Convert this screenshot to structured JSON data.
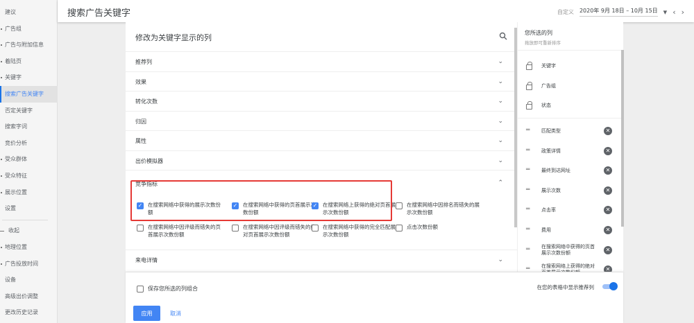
{
  "sidebar": {
    "items": [
      {
        "label": "建议",
        "dot": false
      },
      {
        "label": "广告组",
        "dot": true
      },
      {
        "label": "广告与附加信息",
        "dot": true
      },
      {
        "label": "着陆页",
        "dot": true
      },
      {
        "label": "关键字",
        "dot": true
      },
      {
        "label": "搜索广告关键字",
        "dot": false,
        "active": true
      },
      {
        "label": "否定关键字",
        "dot": false
      },
      {
        "label": "搜索字词",
        "dot": false
      },
      {
        "label": "竞价分析",
        "dot": false
      },
      {
        "label": "受众群体",
        "dot": true
      },
      {
        "label": "受众特征",
        "dot": true
      },
      {
        "label": "展示位置",
        "dot": true
      },
      {
        "label": "设置",
        "dot": false
      }
    ],
    "collapse_label": "收起",
    "more_items": [
      {
        "label": "地理位置",
        "dot": true
      },
      {
        "label": "广告投放时间",
        "dot": true
      },
      {
        "label": "设备",
        "dot": false
      },
      {
        "label": "高级出价调整",
        "dot": false
      },
      {
        "label": "更改历史记录",
        "dot": false
      }
    ]
  },
  "header": {
    "title": "搜索广告关键字",
    "date_label": "自定义",
    "date_value": "2020年 9月 18日 – 10月 15日",
    "prev": "‹",
    "next": "›",
    "dropdown": "▾"
  },
  "main": {
    "title": "修改为关键字显示的列",
    "sections": [
      "推荐列",
      "效果",
      "转化次数",
      "归因",
      "属性",
      "出价模拟器"
    ],
    "competition": {
      "title": "竞争指标",
      "checkboxes": [
        {
          "label": "在搜索网络中获得的展示次数份额",
          "checked": true
        },
        {
          "label": "在搜索网络中获得的页首展示次数份额",
          "checked": true
        },
        {
          "label": "在搜索网络上获得的绝对页首展示次数份额",
          "checked": true
        },
        {
          "label": "在搜索网络中因排名而错失的展示次数份额",
          "checked": false
        },
        {
          "label": "在搜索网络中因评级而错失的页首展示次数份额",
          "checked": false
        },
        {
          "label": "在搜索网络中因评级而错失的绝对页首展示次数份额",
          "checked": false
        },
        {
          "label": "在搜索网络中获得的完全匹配展示次数份额",
          "checked": false
        },
        {
          "label": "点击次数份额",
          "checked": false
        }
      ]
    },
    "after_section": "来电详情"
  },
  "right": {
    "title": "您所选的列",
    "subtitle": "拖放即可重新排序",
    "locked": [
      "关键字",
      "广告组",
      "状态"
    ],
    "items": [
      "匹配类型",
      "政策详情",
      "最终到达网址",
      "展示次数",
      "点击率",
      "费用",
      "在搜索网络中获得的页首展示次数份额",
      "在搜索网络上获得的绝对页首展示次数份额"
    ]
  },
  "footer": {
    "save_combo": "保存您所选的列组合",
    "show_recommended": "在您的表格中显示推荐列",
    "apply": "应用",
    "cancel": "取消"
  },
  "colors": {
    "accent": "#4285f4",
    "highlight": "#e53935"
  }
}
